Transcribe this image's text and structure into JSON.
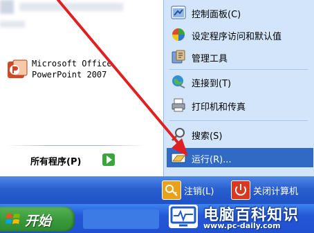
{
  "pinned_programs": [
    {
      "label": "Microsoft Office\nPowerPoint 2007",
      "icon": "powerpoint-icon"
    }
  ],
  "all_programs": {
    "label": "所有程序(P)",
    "icon": "green-arrow-icon"
  },
  "right_menu": {
    "items": [
      {
        "label": "控制面板(C)",
        "icon": "control-panel-icon"
      },
      {
        "label": "设定程序访问和默认值",
        "icon": "program-access-icon"
      },
      {
        "label": "管理工具",
        "icon": "admin-tools-icon"
      },
      {
        "label": "连接到(T)",
        "icon": "connect-to-icon"
      },
      {
        "label": "打印机和传真",
        "icon": "printer-fax-icon"
      },
      {
        "label": "搜索(S)",
        "icon": "search-icon"
      },
      {
        "label": "运行(R)...",
        "icon": "run-icon",
        "selected": true
      }
    ]
  },
  "bottom_bar": {
    "logoff_label": "注销(L)",
    "shutdown_label": "关闭计算机"
  },
  "taskbar": {
    "start_label": "开始"
  },
  "watermark": {
    "title": "电脑百科知识",
    "url": "www.pc-daily.com"
  },
  "colors": {
    "menu_blue": "#d3e5fa",
    "selection": "#316ac5",
    "taskbar_blue": "#2457d6",
    "start_green": "#3a9a3c",
    "annotation_red": "#e02020"
  }
}
